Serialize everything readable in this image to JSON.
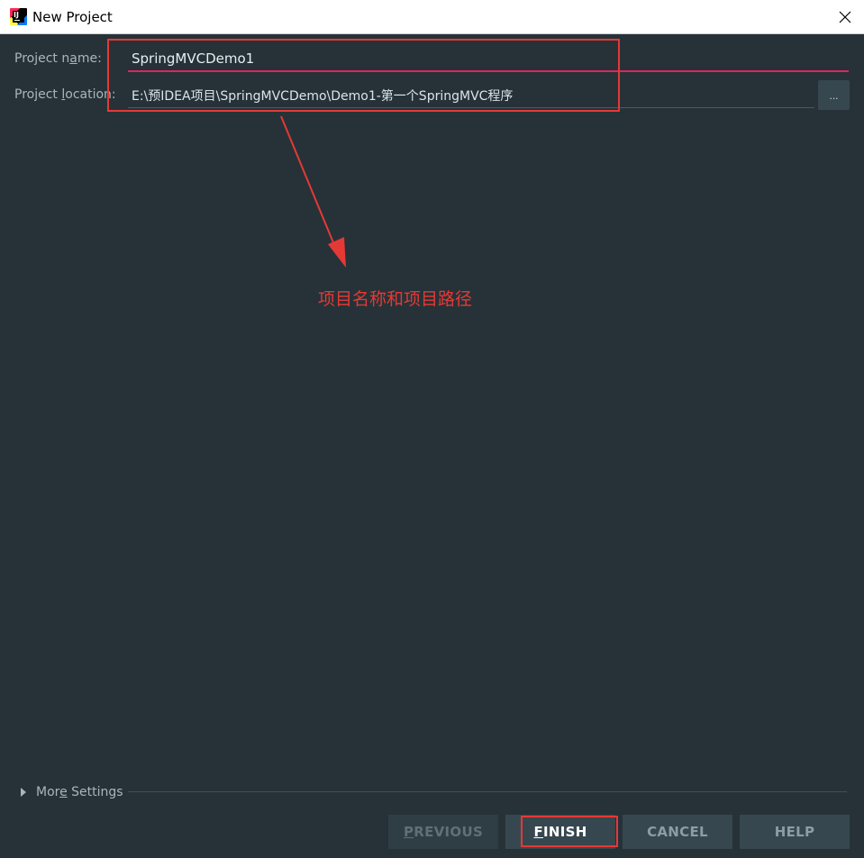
{
  "window": {
    "title": "New Project"
  },
  "form": {
    "name_label_pre": "Project n",
    "name_label_ul": "a",
    "name_label_post": "me:",
    "name_value": "SpringMVCDemo1",
    "location_label_pre": "Project ",
    "location_label_ul": "l",
    "location_label_post": "ocation:",
    "location_value": "E:\\预IDEA项目\\SpringMVCDemo\\Demo1-第一个SpringMVC程序",
    "browse_label": "..."
  },
  "annotation": {
    "text": "项目名称和项目路径",
    "color": "#e53935"
  },
  "more_settings": {
    "label_pre": "Mor",
    "label_ul": "e",
    "label_post": " Settings"
  },
  "buttons": {
    "previous": {
      "ul": "P",
      "rest": "REVIOUS"
    },
    "finish": {
      "ul": "F",
      "rest": "INISH"
    },
    "cancel": "CANCEL",
    "help": "HELP"
  },
  "icons": {
    "app": "intellij-idea-icon",
    "close": "close-icon",
    "more": "triangle-right-icon"
  },
  "colors": {
    "background": "#263238",
    "accent_underline": "#e0245e",
    "annotation_red": "#e53935"
  }
}
